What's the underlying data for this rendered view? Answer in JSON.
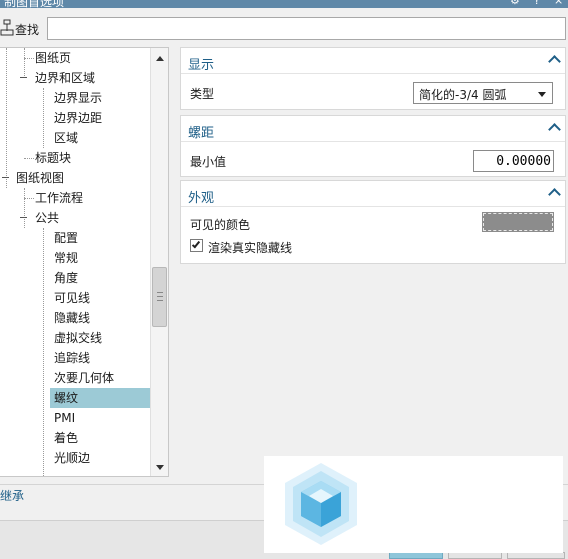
{
  "window": {
    "title": "制图首选项"
  },
  "search": {
    "label": "查找",
    "value": "",
    "placeholder": ""
  },
  "tree": {
    "items": [
      {
        "label": "图纸页",
        "selected": false
      },
      {
        "label": "边界和区域",
        "selected": false
      },
      {
        "label": "边界显示",
        "selected": false
      },
      {
        "label": "边界边距",
        "selected": false
      },
      {
        "label": "区域",
        "selected": false
      },
      {
        "label": "标题块",
        "selected": false
      },
      {
        "label": "图纸视图",
        "selected": false
      },
      {
        "label": "工作流程",
        "selected": false
      },
      {
        "label": "公共",
        "selected": false
      },
      {
        "label": "配置",
        "selected": false
      },
      {
        "label": "常规",
        "selected": false
      },
      {
        "label": "角度",
        "selected": false
      },
      {
        "label": "可见线",
        "selected": false
      },
      {
        "label": "隐藏线",
        "selected": false
      },
      {
        "label": "虚拟交线",
        "selected": false
      },
      {
        "label": "追踪线",
        "selected": false
      },
      {
        "label": "次要几何体",
        "selected": false
      },
      {
        "label": "螺纹",
        "selected": true
      },
      {
        "label": "PMI",
        "selected": false
      },
      {
        "label": "着色",
        "selected": false
      },
      {
        "label": "光顺边",
        "selected": false
      }
    ]
  },
  "sections": {
    "display": {
      "title": "显示",
      "type_label": "类型",
      "type_value": "简化的-3/4 圆弧"
    },
    "pitch": {
      "title": "螺距",
      "min_label": "最小值",
      "min_value": "0.00000"
    },
    "appearance": {
      "title": "外观",
      "color_label": "可见的颜色",
      "color_value": "#8c8c8c",
      "checkbox_label": "渲染真实隐藏线",
      "checkbox_checked": true
    }
  },
  "footer": {
    "inherit_label": "继承"
  },
  "colors": {
    "accent": "#1f5f88",
    "selection": "#9ccad6",
    "titlebar": "#5f88a8"
  }
}
